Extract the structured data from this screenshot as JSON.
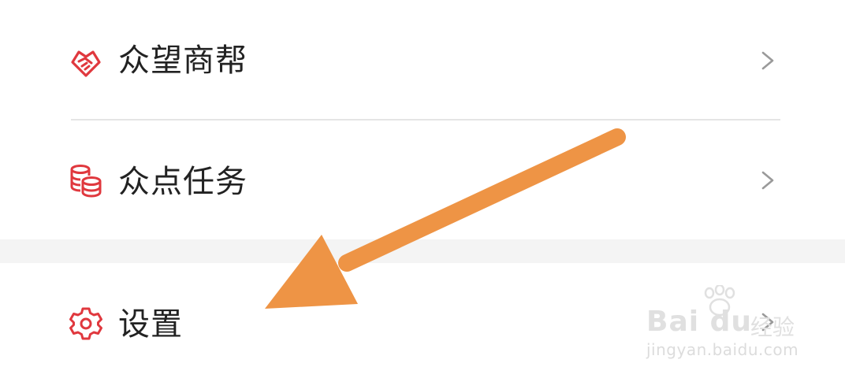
{
  "menu": {
    "items": [
      {
        "label": "众望商帮",
        "icon": "handshake-icon"
      },
      {
        "label": "众点任务",
        "icon": "coin-stack-icon"
      },
      {
        "label": "设置",
        "icon": "gear-icon"
      }
    ]
  },
  "colors": {
    "icon_red": "#e0383e",
    "label_text": "#222222",
    "chevron": "#9a9a9a",
    "annotation_arrow": "#ee9445",
    "divider": "#e5e5e5",
    "section_gap": "#f4f4f4"
  },
  "watermark": {
    "brand": "Bai du",
    "sub": "经验",
    "url": "jingyan.baidu.com"
  }
}
